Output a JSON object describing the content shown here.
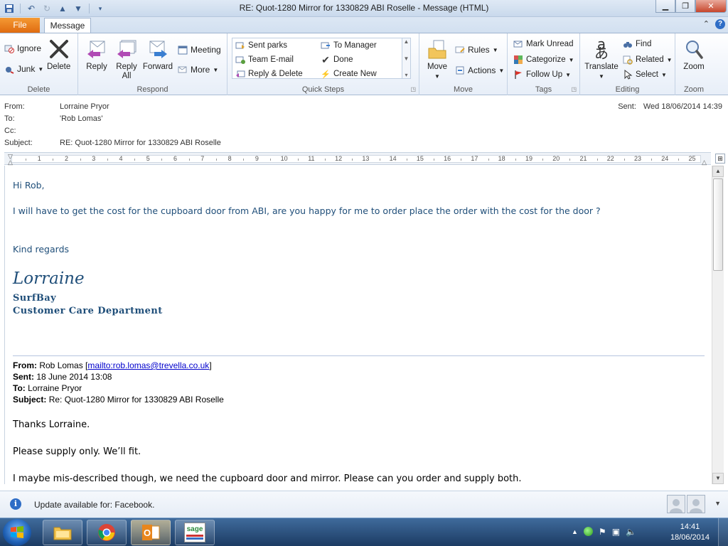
{
  "window": {
    "title": "RE: Quot-1280 Mirror for 1330829 ABI Roselle  -  Message (HTML)"
  },
  "tabs": {
    "file": "File",
    "message": "Message"
  },
  "ribbon": {
    "delete_group": {
      "label": "Delete",
      "ignore": "Ignore",
      "junk": "Junk",
      "delete": "Delete"
    },
    "respond_group": {
      "label": "Respond",
      "reply": "Reply",
      "reply_all": "Reply All",
      "forward": "Forward",
      "meeting": "Meeting",
      "more": "More"
    },
    "quick_steps_group": {
      "label": "Quick Steps",
      "items": [
        "Sent parks",
        "To Manager",
        "Team E-mail",
        "Done",
        "Reply & Delete",
        "Create New"
      ]
    },
    "move_group": {
      "label": "Move",
      "move": "Move",
      "rules": "Rules",
      "actions": "Actions"
    },
    "tags_group": {
      "label": "Tags",
      "mark_unread": "Mark Unread",
      "categorize": "Categorize",
      "follow_up": "Follow Up"
    },
    "editing_group": {
      "label": "Editing",
      "translate": "Translate",
      "find": "Find",
      "related": "Related",
      "select": "Select"
    },
    "zoom_group": {
      "label": "Zoom",
      "zoom": "Zoom"
    }
  },
  "headers": {
    "from_label": "From:",
    "from": "Lorraine Pryor",
    "to_label": "To:",
    "to": "'Rob Lomas'",
    "cc_label": "Cc:",
    "cc": "",
    "subject_label": "Subject:",
    "subject": "RE: Quot-1280 Mirror for 1330829 ABI Roselle",
    "sent_label": "Sent:",
    "sent": "Wed 18/06/2014 14:39"
  },
  "ruler": {
    "numbers": [
      "1",
      "2",
      "3",
      "4",
      "5",
      "6",
      "7",
      "8",
      "9",
      "10",
      "11",
      "12",
      "13",
      "14",
      "15",
      "16",
      "17",
      "18",
      "19",
      "20",
      "21",
      "22",
      "23",
      "24",
      "25"
    ]
  },
  "body": {
    "greeting": "Hi Rob,",
    "line1": "I will have to get the cost for the cupboard door from ABI, are you happy for me to order place the order with the cost for the door ?",
    "closing": "Kind regards",
    "sig_name": "Lorraine",
    "sig_company": "SurfBay",
    "sig_department": "Customer Care Department",
    "original": {
      "from_label": "From:",
      "from_name": "Rob Lomas [",
      "from_link": "mailto:rob.lomas@trevella.co.uk",
      "from_end": "]",
      "sent_label": "Sent:",
      "sent": "18 June 2014 13:08",
      "to_label": "To:",
      "to": "Lorraine Pryor",
      "subject_label": "Subject:",
      "subject": "Re: Quot-1280 Mirror for 1330829 ABI Roselle"
    },
    "quoted_1": "Thanks Lorraine.",
    "quoted_2": "Please supply only. We’ll fit.",
    "quoted_3": "I maybe mis-described though, we need the cupboard door and mirror. Please can you order and supply both."
  },
  "peoplebar": {
    "text": "Update available for: Facebook."
  },
  "taskbar": {
    "time": "14:41",
    "date": "18/06/2014",
    "apps": [
      "explorer-icon",
      "chrome-icon",
      "outlook-icon",
      "sage-icon"
    ],
    "sage_label": "sage"
  },
  "colors": {
    "body_text": "#1f4e79",
    "file_tab": "#e8781c",
    "link": "#0000cc"
  }
}
